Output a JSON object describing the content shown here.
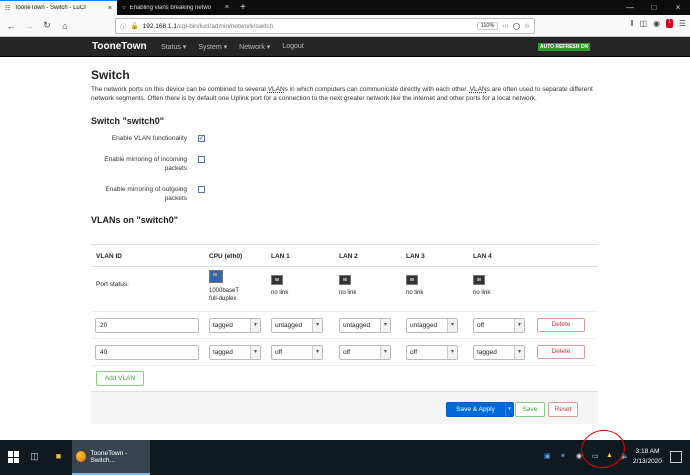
{
  "browser": {
    "tabs": [
      {
        "label": "TooneTown - Switch - LuCI",
        "active": true
      },
      {
        "label": "Enabling vlans breaking netwo",
        "active": false
      }
    ],
    "new_tab": "+",
    "url_host": "192.168.1.1",
    "url_path": "/cgi-bin/luci/admin/network/switch",
    "zoom": "110%",
    "notification_count": "1"
  },
  "luci": {
    "brand": "TooneTown",
    "menu": [
      "Status",
      "System",
      "Network",
      "Logout"
    ],
    "auto_refresh": "AUTO REFRESH ON"
  },
  "page": {
    "title": "Switch",
    "description_parts": [
      "The network ports on this device can be combined to several ",
      "VLAN",
      "s in which computers can communicate directly with each other. ",
      "VLAN",
      "s are often used to separate different network segments. Often there is by default one Uplink port for a connection to the next greater network like the internet and other ports for a local network."
    ],
    "switch_section": "Switch \"switch0\"",
    "options": [
      {
        "label": "Enable VLAN functionality",
        "checked": true
      },
      {
        "label": "Enable mirroring of incoming packets",
        "checked": false
      },
      {
        "label": "Enable mirroring of outgoing packets",
        "checked": false
      }
    ],
    "vlans_title": "VLANs on \"switch0\""
  },
  "vlan_table": {
    "headers": [
      "VLAN ID",
      "CPU (eth0)",
      "LAN 1",
      "LAN 2",
      "LAN 3",
      "LAN 4"
    ],
    "port_status_label": "Port status:",
    "port_status": [
      {
        "port": "CPU (eth0)",
        "line1": "1000baseT",
        "line2": "full-duplex",
        "up": true
      },
      {
        "port": "LAN 1",
        "line1": "no link",
        "line2": "",
        "up": false
      },
      {
        "port": "LAN 2",
        "line1": "no link",
        "line2": "",
        "up": false
      },
      {
        "port": "LAN 3",
        "line1": "no link",
        "line2": "",
        "up": false
      },
      {
        "port": "LAN 4",
        "line1": "no link",
        "line2": "",
        "up": false
      }
    ],
    "rows": [
      {
        "vlan_id": "20",
        "values": [
          "tagged",
          "untagged",
          "untagged",
          "untagged",
          "off"
        ]
      },
      {
        "vlan_id": "40",
        "values": [
          "tagged",
          "off",
          "off",
          "off",
          "tagged"
        ]
      }
    ],
    "delete_label": "Delete",
    "add_label": "Add VLAN"
  },
  "actions": {
    "save_apply": "Save & Apply",
    "save": "Save",
    "reset": "Reset"
  },
  "taskbar": {
    "app_label": "TooneTown - Switch...",
    "time": "3:18 AM",
    "date": "2/13/2020"
  },
  "colors": {
    "header_bg": "#252525",
    "primary": "#0069d9",
    "positive": "#3a3",
    "negative": "#c33",
    "annotation": "#e00"
  }
}
